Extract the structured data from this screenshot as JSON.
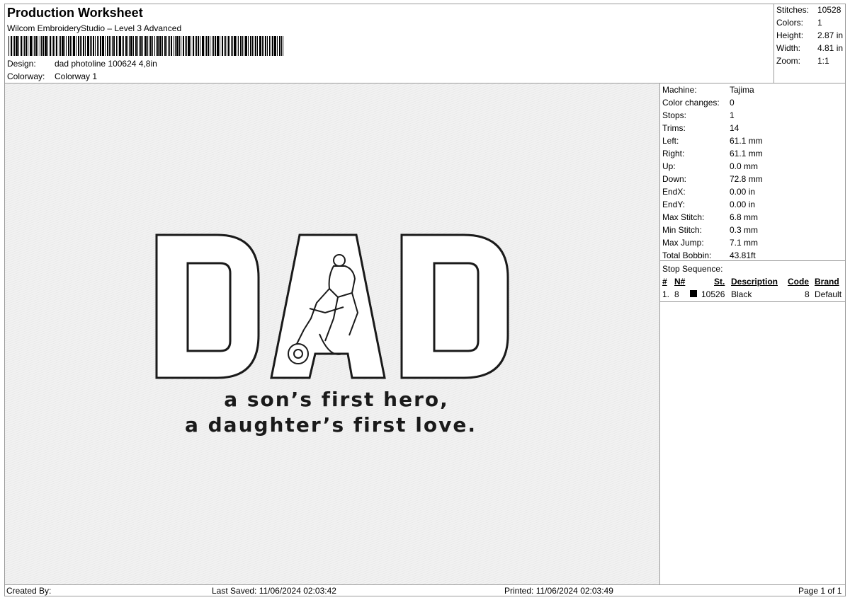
{
  "header": {
    "title": "Production Worksheet",
    "subtitle": "Wilcom EmbroideryStudio – Level 3 Advanced",
    "design_label": "Design:",
    "design_value": "dad photoline 100624 4,8in",
    "colorway_label": "Colorway:",
    "colorway_value": "Colorway 1"
  },
  "summary": [
    {
      "label": "Stitches:",
      "value": "10528"
    },
    {
      "label": "Colors:",
      "value": "1"
    },
    {
      "label": "Height:",
      "value": "2.87 in"
    },
    {
      "label": "Width:",
      "value": "4.81 in"
    },
    {
      "label": "Zoom:",
      "value": "1:1"
    }
  ],
  "details": [
    {
      "label": "Machine:",
      "value": "Tajima"
    },
    {
      "label": "Color changes:",
      "value": "0"
    },
    {
      "label": "Stops:",
      "value": "1"
    },
    {
      "label": "Trims:",
      "value": "14"
    },
    {
      "label": "Left:",
      "value": "61.1 mm"
    },
    {
      "label": "Right:",
      "value": "61.1 mm"
    },
    {
      "label": "Up:",
      "value": "0.0 mm"
    },
    {
      "label": "Down:",
      "value": "72.8 mm"
    },
    {
      "label": "EndX:",
      "value": "0.00 in"
    },
    {
      "label": "EndY:",
      "value": "0.00 in"
    },
    {
      "label": "Max Stitch:",
      "value": "6.8 mm"
    },
    {
      "label": "Min Stitch:",
      "value": "0.3 mm"
    },
    {
      "label": "Max Jump:",
      "value": "7.1 mm"
    },
    {
      "label": "Total Bobbin:",
      "value": "43.81ft"
    }
  ],
  "stop_sequence": {
    "label": "Stop Sequence:",
    "columns": {
      "idx": "#",
      "needle": "N#",
      "stitches": "St.",
      "description": "Description",
      "code": "Code",
      "brand": "Brand"
    },
    "rows": [
      {
        "idx": "1.",
        "needle": "8",
        "swatch_color": "#000000",
        "stitches": "10526",
        "description": "Black",
        "code": "8",
        "brand": "Default"
      }
    ]
  },
  "design": {
    "word": "DAD",
    "line1": "a son’s first hero,",
    "line2": "a daughter’s first love."
  },
  "footer": {
    "created_by": "Created By:",
    "last_saved": "Last Saved: 11/06/2024 02:03:42",
    "printed": "Printed: 11/06/2024 02:03:49",
    "page": "Page 1 of 1"
  },
  "colors": {
    "thread": "#1a1a1a",
    "canvas": "#efefef",
    "border": "#9a9a9a"
  }
}
